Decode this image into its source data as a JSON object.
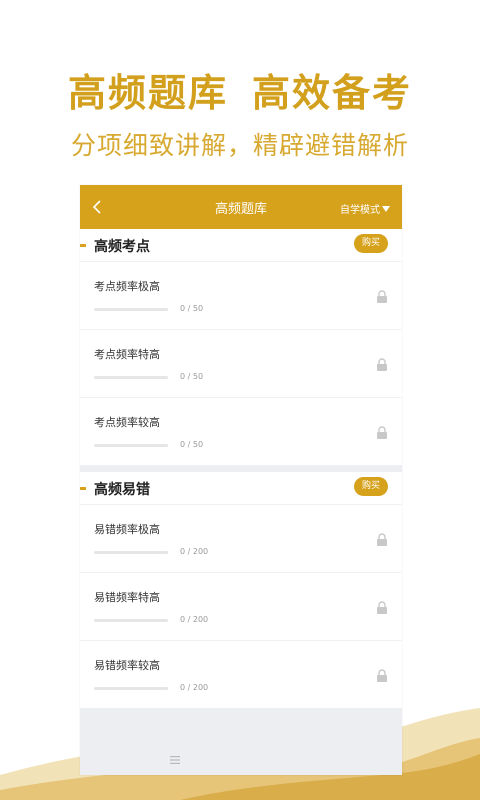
{
  "hero": {
    "title_left": "高频题库",
    "title_right": "高效备考",
    "subtitle": "分项细致讲解，精辟避错解析"
  },
  "navbar": {
    "back_icon": "chevron-left-icon",
    "title": "高频题库",
    "mode": "自学模式",
    "mode_icon": "caret-down-icon"
  },
  "sections": [
    {
      "title": "高频考点",
      "buy_label": "购买",
      "rows": [
        {
          "title": "考点频率极高",
          "count": "0 / 50"
        },
        {
          "title": "考点频率特高",
          "count": "0 / 50"
        },
        {
          "title": "考点频率较高",
          "count": "0 / 50"
        }
      ]
    },
    {
      "title": "高频易错",
      "buy_label": "购买",
      "rows": [
        {
          "title": "易错频率极高",
          "count": "0 / 200"
        },
        {
          "title": "易错频率特高",
          "count": "0 / 200"
        },
        {
          "title": "易错频率较高",
          "count": "0 / 200"
        }
      ]
    }
  ],
  "colors": {
    "accent": "#d6a21c",
    "hero_title": "#d2a01c",
    "hero_subtitle": "#d7a930",
    "background": "#eceef2"
  }
}
